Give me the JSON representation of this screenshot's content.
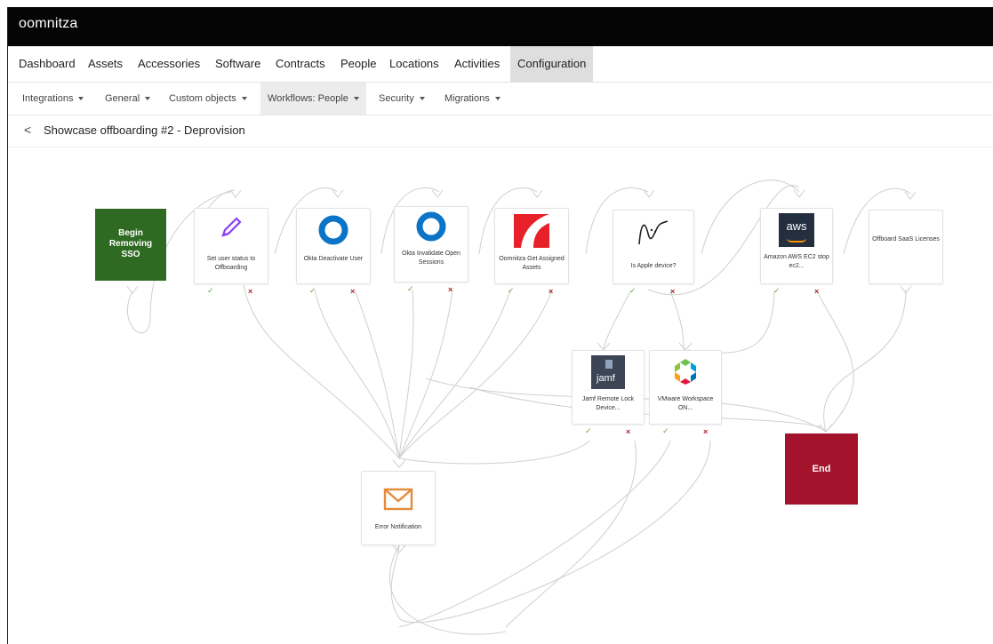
{
  "app": {
    "brand": "oomnitza"
  },
  "main_nav": [
    "Dashboard",
    "Assets",
    "Accessories",
    "Software",
    "Contracts",
    "People",
    "Locations",
    "Activities",
    "Configuration"
  ],
  "sub_nav": [
    "Integrations",
    "General",
    "Custom objects",
    "Workflows: People",
    "Security",
    "Migrations"
  ],
  "page": {
    "title": "Showcase offboarding #2 - Deprovision",
    "back_glyph": "<"
  },
  "workflow": {
    "start": "Begin Removing SSO",
    "end": "End",
    "blocks": {
      "set_status": "Set user status to Offboarding",
      "okta_deactivate": "Okta Deactivate User",
      "okta_invalidate": "Okta Invalidate Open Sessions",
      "oomnitza_assets": "Oomnitza Get Assigned Assets",
      "is_apple": "Is Apple device?",
      "aws_stop": "Amazon AWS EC2 stop ec2...",
      "offboard_saas": "Offboard SaaS Licenses",
      "jamf_lock": "Jamf Remote Lock Device...",
      "vmware": "VMware Workspace ON...",
      "error_notification": "Error Notification"
    },
    "icon_text": {
      "aws": "aws",
      "jamf": "jamf"
    },
    "success_glyph": "✓",
    "fail_glyph": "×"
  },
  "colors": {
    "start": "#2f6a23",
    "end": "#a3142c",
    "okta": "#0b74c6",
    "pencil": "#8a3ff2",
    "oomnitza": "#e8202a",
    "mail": "#e58b3a"
  }
}
